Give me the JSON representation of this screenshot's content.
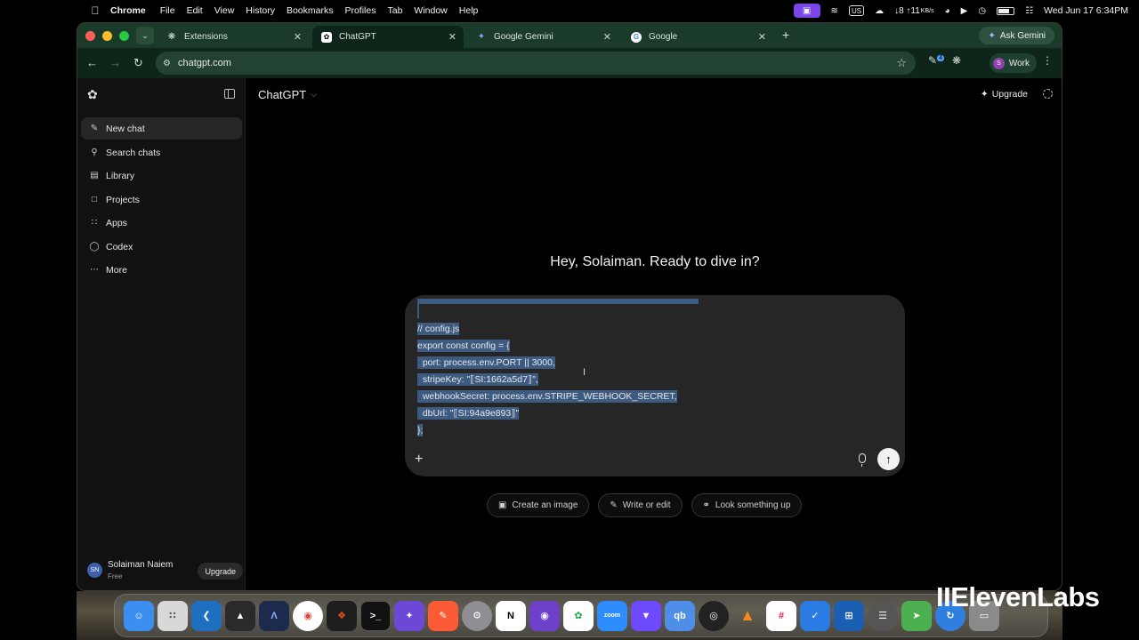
{
  "menubar": {
    "apple_icon": "apple-logo-icon",
    "items": [
      "Chrome",
      "File",
      "Edit",
      "View",
      "History",
      "Bookmarks",
      "Profiles",
      "Tab",
      "Window",
      "Help"
    ],
    "network": "↓8 ↑11",
    "network_unit": "KB/s",
    "input_source": "US",
    "datetime": "Wed Jun 17  6:34PM"
  },
  "browser": {
    "tabs": [
      {
        "title": "Extensions",
        "icon": "puzzle-icon",
        "active": false
      },
      {
        "title": "ChatGPT",
        "icon": "chatgpt-icon",
        "active": true
      },
      {
        "title": "Google Gemini",
        "icon": "gemini-icon",
        "active": false
      },
      {
        "title": "Google",
        "icon": "google-icon",
        "active": false
      }
    ],
    "ask_gemini": "Ask Gemini",
    "url": "chatgpt.com",
    "profile_initial": "S",
    "profile_label": "Work",
    "extension_badge": "4"
  },
  "sidebar": {
    "items": [
      {
        "label": "New chat",
        "icon": "compose-icon",
        "active": true
      },
      {
        "label": "Search chats",
        "icon": "search-icon",
        "active": false
      },
      {
        "label": "Library",
        "icon": "library-icon",
        "active": false
      },
      {
        "label": "Projects",
        "icon": "folder-icon",
        "active": false
      },
      {
        "label": "Apps",
        "icon": "apps-grid-icon",
        "active": false
      },
      {
        "label": "Codex",
        "icon": "codex-icon",
        "active": false
      },
      {
        "label": "More",
        "icon": "more-dots-icon",
        "active": false
      }
    ],
    "user": {
      "initials": "SN",
      "name": "Solaiman Naiem",
      "plan": "Free",
      "upgrade": "Upgrade"
    }
  },
  "main": {
    "model": "ChatGPT",
    "upgrade": "Upgrade",
    "greeting": "Hey, Solaiman. Ready to dive in?",
    "composer_lines": [
      "// config.js",
      "export const config = {",
      "  port: process.env.PORT || 3000,",
      "  stripeKey: \"⟦SI:1662a5d7⟧\",",
      "  webhookSecret: process.env.STRIPE_WEBHOOK_SECRET,",
      "  dbUrl: \"⟦SI:94a9e893⟧\"",
      "};"
    ],
    "chips": [
      {
        "label": "Create an image",
        "icon": "image-icon"
      },
      {
        "label": "Write or edit",
        "icon": "pencil-icon"
      },
      {
        "label": "Look something up",
        "icon": "globe-icon"
      }
    ]
  },
  "dock": {
    "apps": [
      "Finder",
      "Launchpad",
      "VS Code",
      "Cube",
      "Arc",
      "Chrome",
      "Figma",
      "Terminal",
      "Affinity",
      "Brush",
      "Settings",
      "Notion",
      "GitHub",
      "MongoDB",
      "Zoom",
      "Proton",
      "qb",
      "OBS",
      "VLC",
      "Slack",
      "Tasks",
      "Windows",
      "Mixer",
      "Maps",
      "Spinner",
      "Trash"
    ]
  },
  "watermark": "IIElevenLabs",
  "colors": {
    "tabbar": "#1a3a2a",
    "toolbar": "#0d2619",
    "selection": "#3d5a80",
    "menubar_highlight": "#7b46e8"
  }
}
